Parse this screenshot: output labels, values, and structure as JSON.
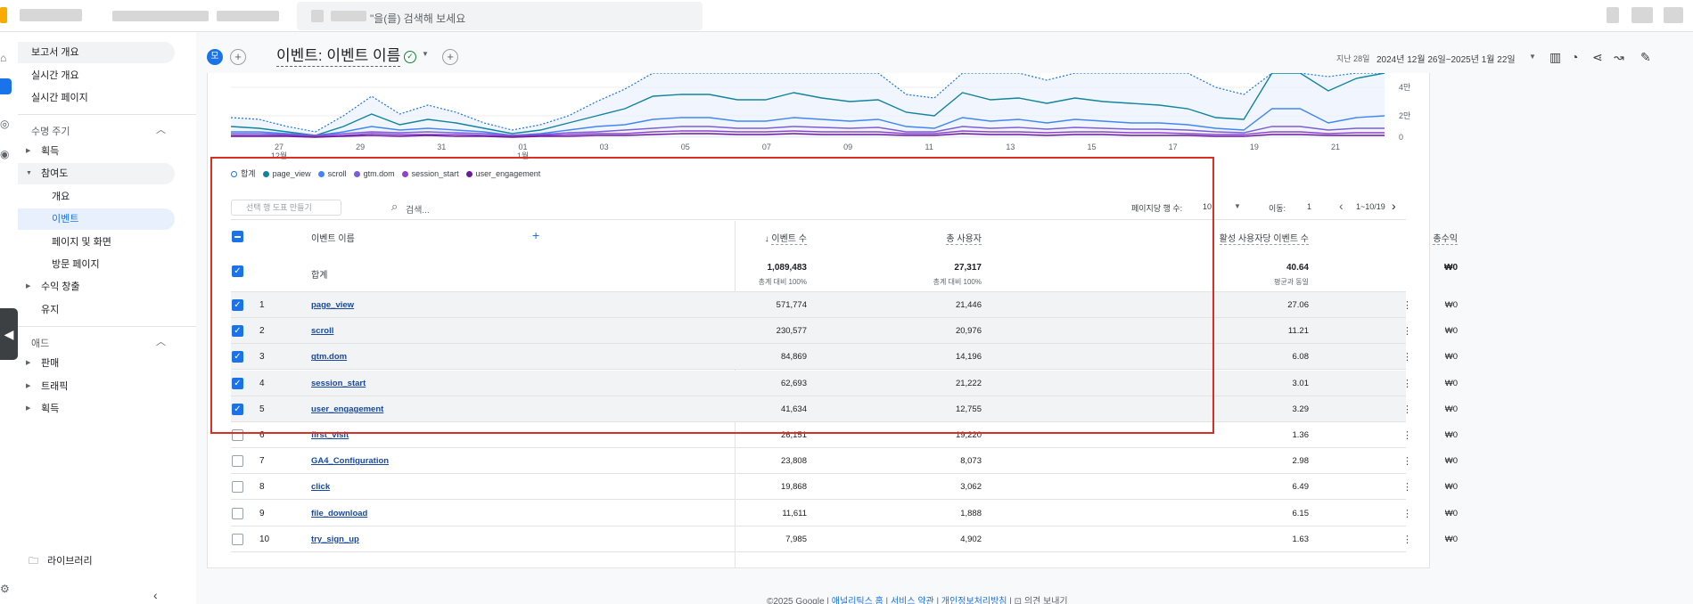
{
  "topbar": {
    "search_placeholder": "\"을(를) 검색해 보세요"
  },
  "sidebar": {
    "items": [
      {
        "label": "보고서 개요"
      },
      {
        "label": "실시간 개요"
      },
      {
        "label": "실시간 페이지"
      }
    ],
    "lifecycle_label": "수명 주기",
    "lifecycle_items": [
      {
        "label": "획득"
      },
      {
        "label": "참여도"
      },
      {
        "label": "개요"
      },
      {
        "label": "이벤트"
      },
      {
        "label": "페이지 및 화면"
      },
      {
        "label": "방문 페이지"
      },
      {
        "label": "수익 창출"
      },
      {
        "label": "유지"
      }
    ],
    "ads_label": "애드",
    "ads_items": [
      {
        "label": "판매"
      },
      {
        "label": "트래픽"
      },
      {
        "label": "획득"
      }
    ],
    "library_label": "라이브러리"
  },
  "header": {
    "chip": "모",
    "title": "이벤트: 이벤트 이름",
    "date_label": "지난 28일",
    "date_range": "2024년 12월 26일~2025년 1월 22일"
  },
  "chart_data": {
    "type": "line",
    "x_labels": [
      "27",
      "29",
      "31",
      "01",
      "03",
      "05",
      "07",
      "09",
      "11",
      "13",
      "15",
      "17",
      "19",
      "21"
    ],
    "x_sublabels": {
      "27": "12월",
      "01": "1월"
    },
    "y_labels": [
      "4만",
      "2만",
      "0"
    ],
    "legend": [
      {
        "name": "합계",
        "color": "#1a73e8",
        "hollow": true
      },
      {
        "name": "page_view",
        "color": "#12849c"
      },
      {
        "name": "scroll",
        "color": "#4285f4"
      },
      {
        "name": "gtm.dom",
        "color": "#7b5dd6"
      },
      {
        "name": "session_start",
        "color": "#8e44c9"
      },
      {
        "name": "user_engagement",
        "color": "#6a1b9a"
      }
    ]
  },
  "table": {
    "segment_placeholder": "선택 행 도표 만들기",
    "search_placeholder": "검색...",
    "rows_per_page_label": "페이지당 행 수:",
    "rows_per_page": "10",
    "goto_label": "이동:",
    "goto_value": "1",
    "page_info": "1~10/19",
    "columns": {
      "name": "이벤트 이름",
      "events": "이벤트 수",
      "users": "총 사용자",
      "per_user": "활성 사용자당 이벤트 수",
      "revenue": "총수익"
    },
    "total": {
      "label": "합계",
      "events": "1,089,483",
      "events_sub": "총계 대비 100%",
      "users": "27,317",
      "users_sub": "총계 대비 100%",
      "per_user": "40.64",
      "per_user_sub": "평균과 동일",
      "revenue": "₩0"
    },
    "rows": [
      {
        "idx": "1",
        "name": "page_view",
        "events": "571,774",
        "users": "21,446",
        "per_user": "27.06",
        "revenue": "₩0",
        "checked": true
      },
      {
        "idx": "2",
        "name": "scroll",
        "events": "230,577",
        "users": "20,976",
        "per_user": "11.21",
        "revenue": "₩0",
        "checked": true
      },
      {
        "idx": "3",
        "name": "gtm.dom",
        "events": "84,869",
        "users": "14,196",
        "per_user": "6.08",
        "revenue": "₩0",
        "checked": true
      },
      {
        "idx": "4",
        "name": "session_start",
        "events": "62,693",
        "users": "21,222",
        "per_user": "3.01",
        "revenue": "₩0",
        "checked": true
      },
      {
        "idx": "5",
        "name": "user_engagement",
        "events": "41,634",
        "users": "12,755",
        "per_user": "3.29",
        "revenue": "₩0",
        "checked": true
      },
      {
        "idx": "6",
        "name": "first_visit",
        "events": "26,151",
        "users": "19,220",
        "per_user": "1.36",
        "revenue": "₩0",
        "checked": false
      },
      {
        "idx": "7",
        "name": "GA4_Configuration",
        "events": "23,808",
        "users": "8,073",
        "per_user": "2.98",
        "revenue": "₩0",
        "checked": false
      },
      {
        "idx": "8",
        "name": "click",
        "events": "19,868",
        "users": "3,062",
        "per_user": "6.49",
        "revenue": "₩0",
        "checked": false
      },
      {
        "idx": "9",
        "name": "file_download",
        "events": "11,611",
        "users": "1,888",
        "per_user": "6.15",
        "revenue": "₩0",
        "checked": false
      },
      {
        "idx": "10",
        "name": "try_sign_up",
        "events": "7,985",
        "users": "4,902",
        "per_user": "1.63",
        "revenue": "₩0",
        "checked": false
      }
    ]
  },
  "footer": {
    "copyright": "©2025 Google |",
    "link1": "애널리틱스 홈",
    "link2": "서비스 약관",
    "link3": "개인정보처리방침",
    "feedback": "의견 보내기"
  }
}
